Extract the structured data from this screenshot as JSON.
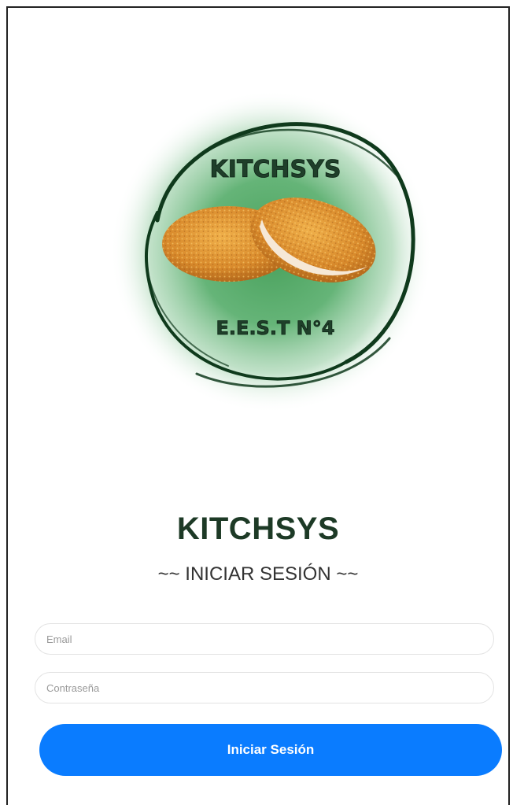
{
  "logo": {
    "top_text": "KITCHSYS",
    "bottom_text": "E.E.S.T N°4",
    "colors": {
      "ring": "#0f3a1c",
      "glow": "#2e9a4c",
      "food": "#d88a2e"
    }
  },
  "header": {
    "title": "KITCHSYS",
    "subtitle": "~~ INICIAR SESIÓN ~~"
  },
  "form": {
    "email_placeholder": "Email",
    "password_placeholder": "Contraseña",
    "submit_label": "Iniciar Sesión"
  },
  "colors": {
    "title": "#1d3a26",
    "button": "#0a7cff"
  }
}
